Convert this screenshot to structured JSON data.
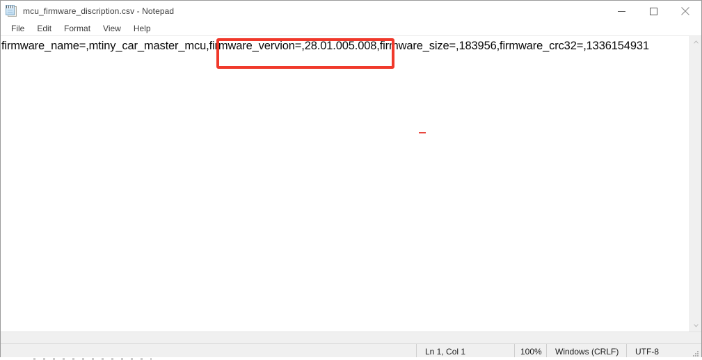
{
  "window": {
    "title": "mcu_firmware_discription.csv - Notepad",
    "icon": "notepad-icon",
    "controls": {
      "minimize": "minimize-icon",
      "maximize": "maximize-icon",
      "close": "close-icon"
    }
  },
  "menubar": {
    "items": [
      {
        "label": "File"
      },
      {
        "label": "Edit"
      },
      {
        "label": "Format"
      },
      {
        "label": "View"
      },
      {
        "label": "Help"
      }
    ]
  },
  "document": {
    "text": "firmware_name=,mtiny_car_master_mcu,firmware_vervion=,28.01.005.008,firmware_size=,183956,firmware_crc32=,1336154931",
    "fields": {
      "firmware_name_key": "firmware_name=",
      "firmware_name_value": "mtiny_car_master_mcu",
      "firmware_version_key": "firmware_vervion=",
      "firmware_version_value": "28.01.005.008",
      "firmware_size_key": "firmware_size=",
      "firmware_size_value": "183956",
      "firmware_crc32_key": "firmware_crc32=",
      "firmware_crc32_value": "1336154931"
    }
  },
  "annotation": {
    "highlight_color": "#f0392b",
    "highlight_target": "firmware_vervion=,28.01.005.008"
  },
  "scrollbars": {
    "vertical_up": "scroll-up-arrow-icon",
    "vertical_down": "scroll-down-arrow-icon"
  },
  "statusbar": {
    "position": "Ln 1, Col 1",
    "zoom": "100%",
    "line_ending": "Windows (CRLF)",
    "encoding": "UTF-8",
    "grip": "resize-grip-icon"
  }
}
